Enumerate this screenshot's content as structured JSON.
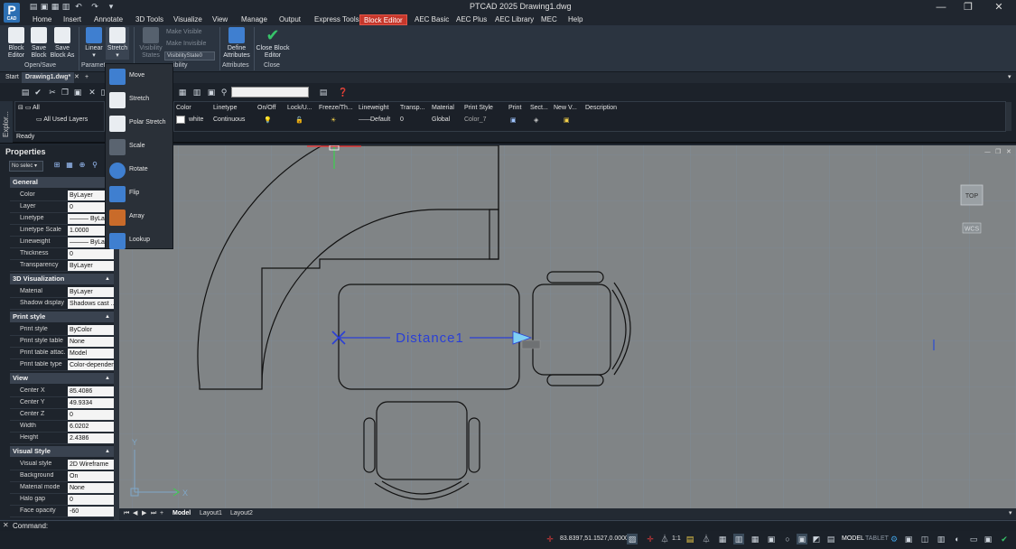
{
  "app": {
    "logo_text": "P",
    "logo_sub": "CAD",
    "title": "PTCAD  2025    Drawing1.dwg"
  },
  "window_controls": {
    "minimize": "—",
    "restore": "❐",
    "close": "✕"
  },
  "menu_tabs": [
    "Home",
    "Insert",
    "Annotate",
    "3D Tools",
    "Visualize",
    "View",
    "Manage",
    "Output",
    "Express Tools",
    "Block Editor",
    "AEC Basic",
    "AEC Plus",
    "AEC Library",
    "MEC",
    "Help"
  ],
  "active_menu_tab": "Block Editor",
  "ribbon": {
    "block_editor": "Block\nEditor",
    "save_block": "Save\nBlock",
    "save_block_as": "Save\nBlock As",
    "linear": "Linear",
    "stretch": "Stretch",
    "visibility_states": "Visibility\nStates",
    "make_visible": "Make Visible",
    "make_invisible": "Make Invisible",
    "visibility_state_value": "VisibilityState0",
    "define_attributes": "Define\nAttributes",
    "close_block_editor": "Close Block\nEditor",
    "group_open_save": "Open/Save",
    "group_parameters": "Paramete",
    "group_visibility": "ibility",
    "group_attributes": "Attributes",
    "group_close": "Close"
  },
  "dropdown_items": [
    "Move",
    "Stretch",
    "Polar Stretch",
    "Scale",
    "Rotate",
    "Flip",
    "Array",
    "Lookup"
  ],
  "doc_tabs": {
    "start": "Start",
    "drawing": "Drawing1.dwg*",
    "close": "✕",
    "add": "+"
  },
  "explorer": {
    "side_label": "Explor...",
    "tree_root": "All",
    "tree_child": "All Used Layers",
    "status": "Ready",
    "search_value": ""
  },
  "layer_table": {
    "headers": [
      "Color",
      "Linetype",
      "On/Off",
      "Lock/U...",
      "Freeze/Th...",
      "Lineweight",
      "Transp...",
      "Material",
      "Print Style",
      "Print",
      "Sect...",
      "New V...",
      "Description"
    ],
    "row": {
      "color": "white",
      "linetype": "Continuous",
      "lineweight": "Default",
      "transparency": "0",
      "material": "Global",
      "print_style": "Color_7"
    }
  },
  "properties": {
    "title": "Properties",
    "selection": "No selec",
    "sections": [
      {
        "name": "General",
        "rows": [
          [
            "Color",
            "ByLayer"
          ],
          [
            "Layer",
            "0"
          ],
          [
            "Linetype",
            "——— ByLayer"
          ],
          [
            "Linetype Scale",
            "1.0000"
          ],
          [
            "Lineweight",
            "——— ByLayer"
          ],
          [
            "Thickness",
            "0"
          ],
          [
            "Transparency",
            "ByLayer"
          ]
        ]
      },
      {
        "name": "3D Visualization",
        "rows": [
          [
            "Material",
            "ByLayer"
          ],
          [
            "Shadow display",
            "Shadows cast ..."
          ]
        ]
      },
      {
        "name": "Print style",
        "rows": [
          [
            "Print style",
            "ByColor"
          ],
          [
            "Print style table",
            "None"
          ],
          [
            "Print table attac...",
            "Model"
          ],
          [
            "Print table type",
            "Color-dependen..."
          ]
        ]
      },
      {
        "name": "View",
        "rows": [
          [
            "Center X",
            "85.4086"
          ],
          [
            "Center Y",
            "49.9334"
          ],
          [
            "Center Z",
            "0"
          ],
          [
            "Width",
            "6.0202"
          ],
          [
            "Height",
            "2.4386"
          ]
        ]
      },
      {
        "name": "Visual Style",
        "rows": [
          [
            "Visual style",
            "2D Wireframe"
          ],
          [
            "Background",
            "On"
          ],
          [
            "Material mode",
            "None"
          ],
          [
            "Halo gap",
            "0"
          ],
          [
            "Face opacity",
            "-60"
          ]
        ]
      }
    ]
  },
  "canvas": {
    "parameter_label": "Distance1",
    "viewcube": "TOP",
    "ucs": "WCS",
    "axis_y": "Y",
    "axis_x": "X"
  },
  "layout_tabs": [
    "Model",
    "Layout1",
    "Layout2"
  ],
  "active_layout": "Model",
  "command": {
    "label": "Command:"
  },
  "status": {
    "coords": "83.8397,51.1527,0.0000",
    "scale": "1:1",
    "model": "MODEL",
    "tablet": "TABLET"
  },
  "colors": {
    "accent_red": "#c7372b",
    "canvas": "#808486",
    "param_blue": "#2a3fd6"
  }
}
